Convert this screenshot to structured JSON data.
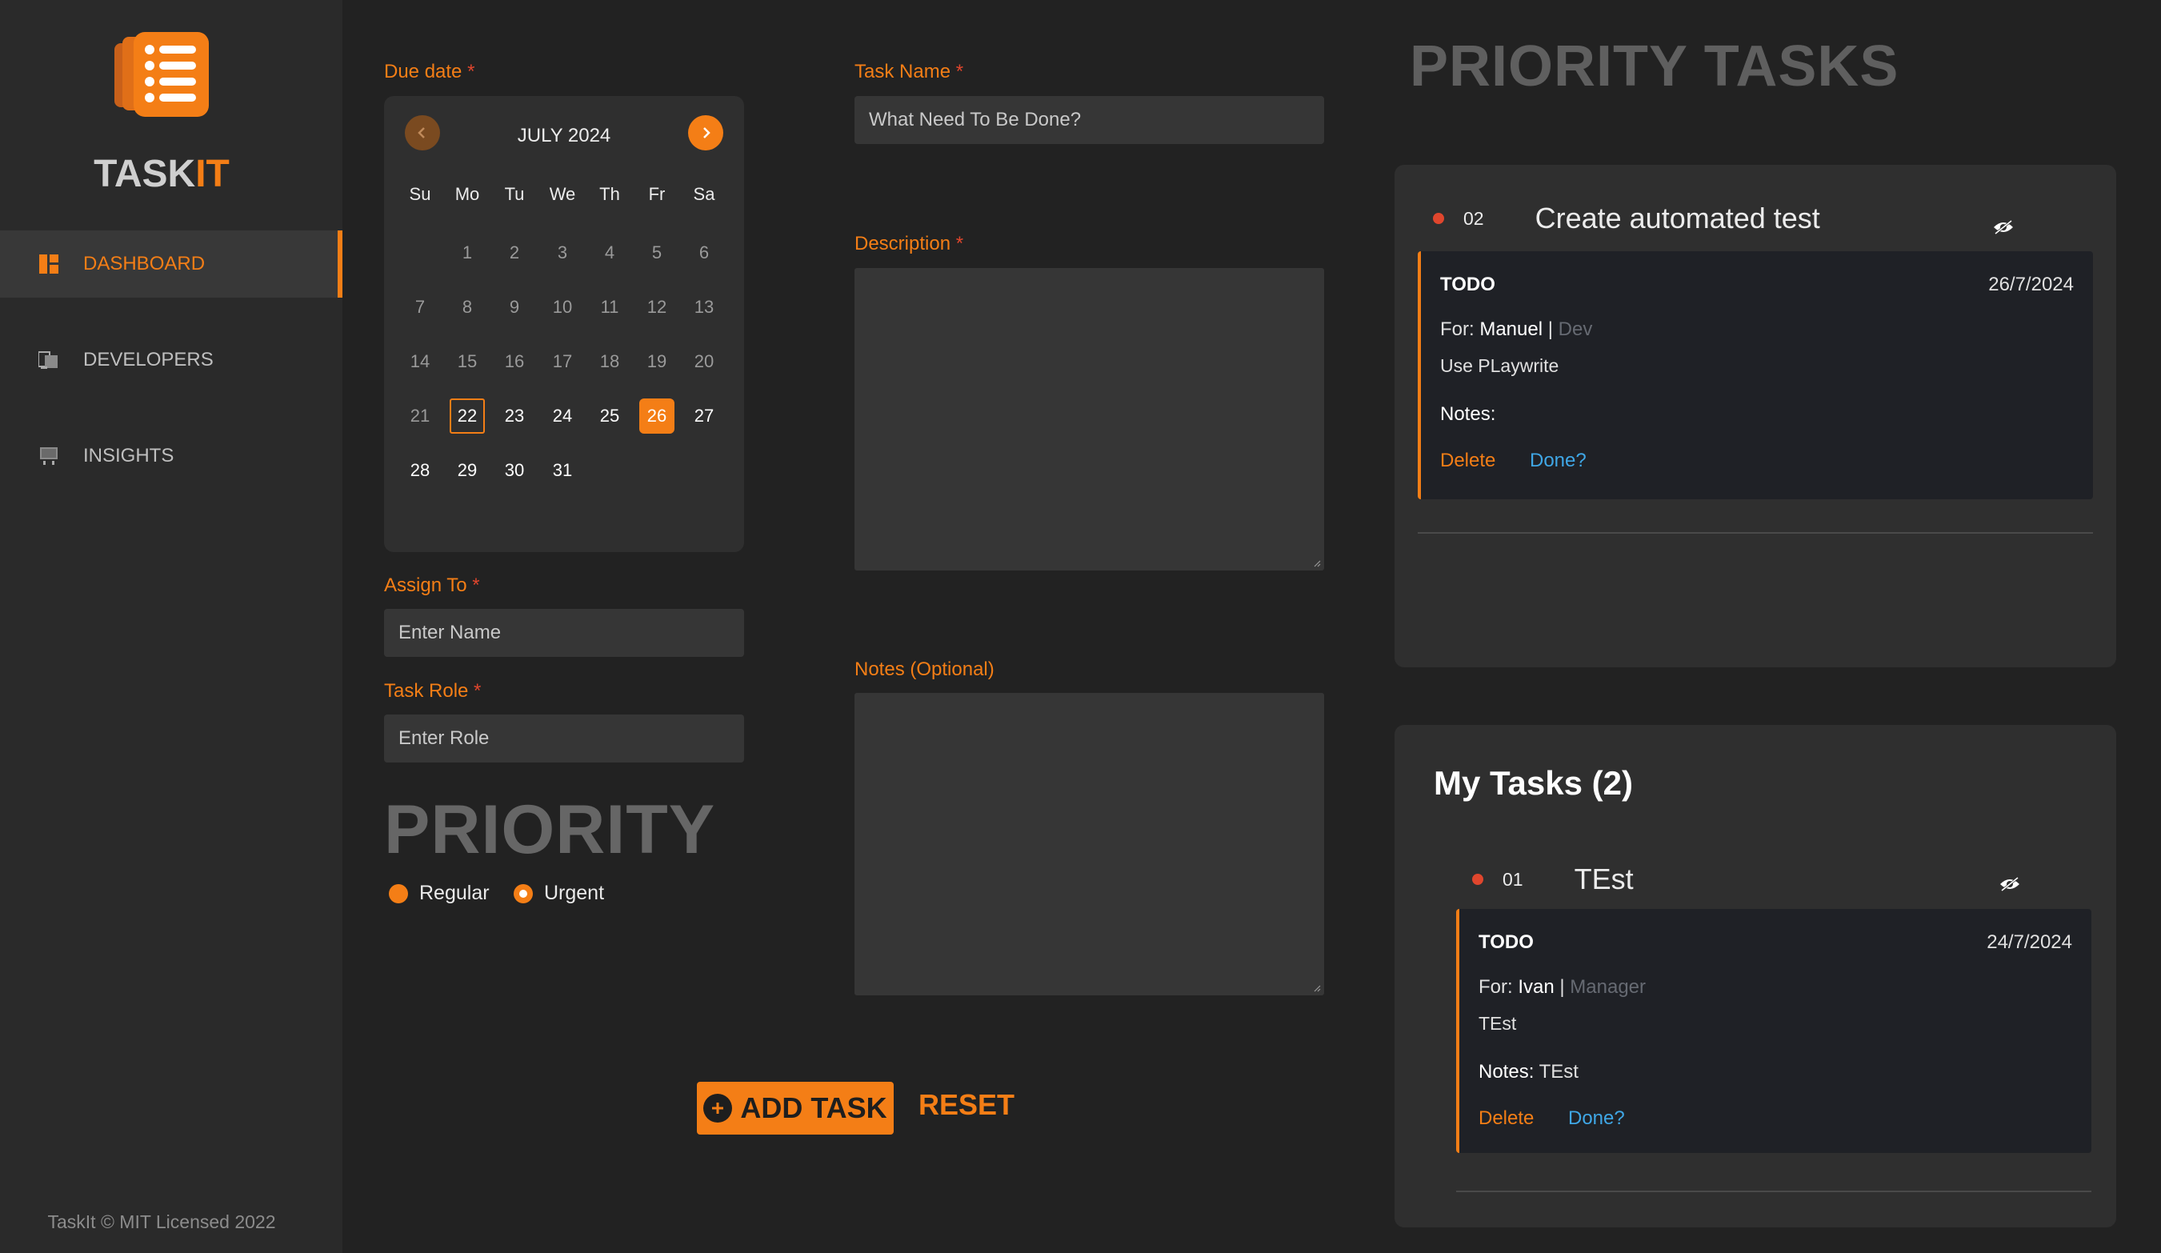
{
  "app": {
    "brand_part1": "TASK",
    "brand_part2": "IT",
    "footer": "TaskIt © MIT Licensed 2022"
  },
  "colors": {
    "accent": "#f47e16",
    "bullet": "#e0462d",
    "link": "#3fa7e6",
    "bg": "#222222",
    "sidebar": "#2a2a2a"
  },
  "nav": [
    {
      "label": "DASHBOARD",
      "icon": "dashboard-icon",
      "active": true
    },
    {
      "label": "DEVELOPERS",
      "icon": "developers-icon",
      "active": false
    },
    {
      "label": "INSIGHTS",
      "icon": "insights-icon",
      "active": false
    }
  ],
  "form": {
    "due_label": "Due date",
    "req": "*",
    "calendar": {
      "title": "JULY 2024",
      "dow": [
        "Su",
        "Mo",
        "Tu",
        "We",
        "Th",
        "Fr",
        "Sa"
      ],
      "weeks": [
        [
          "",
          "1",
          "2",
          "3",
          "4",
          "5",
          "6"
        ],
        [
          "7",
          "8",
          "9",
          "10",
          "11",
          "12",
          "13"
        ],
        [
          "14",
          "15",
          "16",
          "17",
          "18",
          "19",
          "20"
        ],
        [
          "21",
          "22",
          "23",
          "24",
          "25",
          "26",
          "27"
        ],
        [
          "28",
          "29",
          "30",
          "31",
          "",
          "",
          ""
        ]
      ],
      "today": "22",
      "selected": "26",
      "current_from": 22
    },
    "assign_label": "Assign To",
    "assign_placeholder": "Enter Name",
    "role_label": "Task Role",
    "role_placeholder": "Enter Role",
    "priority_heading": "PRIORITY",
    "priority_options": [
      {
        "label": "Regular",
        "checked": false
      },
      {
        "label": "Urgent",
        "checked": true
      }
    ],
    "task_name_label": "Task Name",
    "task_name_placeholder": "What Need To Be Done?",
    "description_label": "Description",
    "notes_label": "Notes (Optional)",
    "add_button": "ADD TASK",
    "reset_button": "RESET"
  },
  "priority_tasks": {
    "heading": "PRIORITY TASKS",
    "task": {
      "num": "02",
      "title": "Create automated test",
      "status": "TODO",
      "date": "26/7/2024",
      "for_label": "For:",
      "assignee": "Manuel",
      "sep": "|",
      "role": "Dev",
      "description": "Use PLaywrite",
      "notes_label": "Notes:",
      "notes": "",
      "delete": "Delete",
      "done": "Done?"
    }
  },
  "my_tasks": {
    "heading": "My Tasks (2)",
    "task": {
      "num": "01",
      "title": "TEst",
      "status": "TODO",
      "date": "24/7/2024",
      "for_label": "For:",
      "assignee": "Ivan",
      "sep": "|",
      "role": "Manager",
      "description": "TEst",
      "notes_label": "Notes:",
      "notes": "TEst",
      "delete": "Delete",
      "done": "Done?"
    }
  }
}
